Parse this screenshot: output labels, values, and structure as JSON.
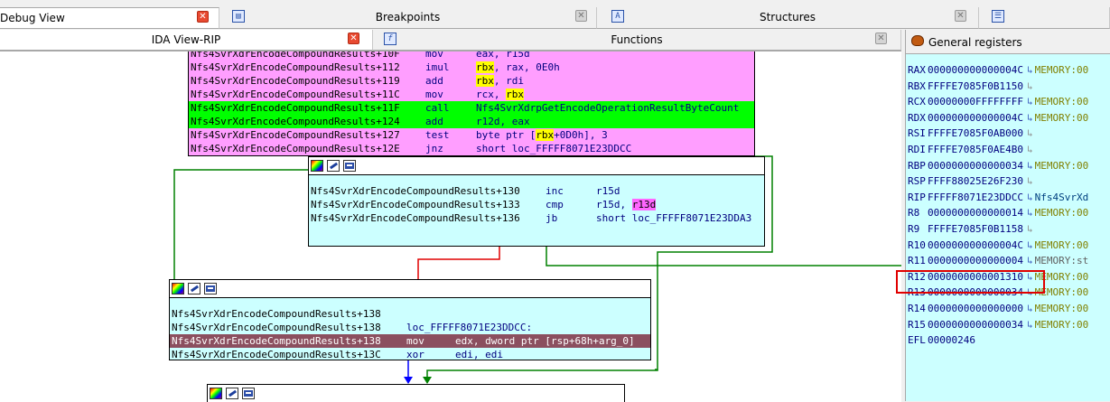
{
  "tabs_top": [
    {
      "label": "Debug View",
      "active": true
    },
    {
      "label": "Breakpoints",
      "active": false
    },
    {
      "label": "Structures",
      "active": false
    }
  ],
  "tabs_second": [
    {
      "label": "IDA View-RIP",
      "active": true
    },
    {
      "label": "Functions",
      "active": false
    }
  ],
  "icons": {
    "breakpoints": "breakpoints-icon",
    "structures": "structures-icon",
    "functions": "functions-icon",
    "extra": "list-icon",
    "registers": "bug-icon"
  },
  "colors": {
    "block_pink": "#ff9eff",
    "block_cyan": "#ccffff",
    "row_green": "#00ff00",
    "row_current": "#8b4f5f",
    "edge_green": "#008000",
    "edge_red": "#e00000",
    "edge_blue": "#0000ff"
  },
  "blocks": [
    {
      "rows": [
        {
          "addr": "Nfs4SvrXdrEncodeCompoundResults+10F",
          "mn": "mov",
          "ops": "eax, r15d",
          "hl": "none"
        },
        {
          "addr": "Nfs4SvrXdrEncodeCompoundResults+112",
          "mn": "imul",
          "ops_pre": "",
          "ops_hl": "rbx",
          "ops_post": ", rax, 0E0h",
          "hl": "none"
        },
        {
          "addr": "Nfs4SvrXdrEncodeCompoundResults+119",
          "mn": "add",
          "ops_pre": "",
          "ops_hl": "rbx",
          "ops_post": ", rdi",
          "hl": "none"
        },
        {
          "addr": "Nfs4SvrXdrEncodeCompoundResults+11C",
          "mn": "mov",
          "ops_pre": "rcx, ",
          "ops_hl": "rbx",
          "ops_post": "",
          "hl": "none"
        },
        {
          "addr": "Nfs4SvrXdrEncodeCompoundResults+11F",
          "mn": "call",
          "ops": "Nfs4SvrXdrpGetEncodeOperationResultByteCount",
          "hl": "green"
        },
        {
          "addr": "Nfs4SvrXdrEncodeCompoundResults+124",
          "mn": "add",
          "ops": "r12d, eax",
          "hl": "green"
        },
        {
          "addr": "Nfs4SvrXdrEncodeCompoundResults+127",
          "mn": "test",
          "ops_pre": "byte ptr [",
          "ops_hl": "rbx",
          "ops_post": "+0D0h], 3",
          "hl": "none"
        },
        {
          "addr": "Nfs4SvrXdrEncodeCompoundResults+12E",
          "mn": "jnz",
          "ops": "short loc_FFFFF8071E23DDCC",
          "hl": "none"
        }
      ]
    },
    {
      "rows": [
        {
          "addr": "Nfs4SvrXdrEncodeCompoundResults+130",
          "mn": "inc",
          "ops": "r15d"
        },
        {
          "addr": "Nfs4SvrXdrEncodeCompoundResults+133",
          "mn": "cmp",
          "ops_pre": "r15d, ",
          "ops_hl": "r13d",
          "ops_post": ""
        },
        {
          "addr": "Nfs4SvrXdrEncodeCompoundResults+136",
          "mn": "jb",
          "ops": "short loc_FFFFF8071E23DDA3"
        }
      ]
    },
    {
      "rows": [
        {
          "addr": "Nfs4SvrXdrEncodeCompoundResults+138",
          "mn": "",
          "ops": ""
        },
        {
          "addr": "Nfs4SvrXdrEncodeCompoundResults+138",
          "mn": "loc_FFFFF8071E23DDCC:",
          "ops": ""
        },
        {
          "addr": "Nfs4SvrXdrEncodeCompoundResults+138",
          "mn": "mov",
          "ops": "edx, dword ptr [rsp+68h+arg_0]",
          "hl": "current"
        },
        {
          "addr": "Nfs4SvrXdrEncodeCompoundResults+13C",
          "mn": "xor",
          "ops": "edi, edi"
        }
      ]
    }
  ],
  "registers_title": "General registers",
  "registers": [
    {
      "name": "RAX",
      "value": "000000000000004C",
      "arrow": "↳",
      "note": "MEMORY:00",
      "kind": "mem"
    },
    {
      "name": "RBX",
      "value": "FFFFE7085F0B1150",
      "arrow": "↳",
      "note": "",
      "kind": "none"
    },
    {
      "name": "RCX",
      "value": "00000000FFFFFFFF",
      "arrow": "↳",
      "note": "MEMORY:00",
      "kind": "mem"
    },
    {
      "name": "RDX",
      "value": "000000000000004C",
      "arrow": "↳",
      "note": "MEMORY:00",
      "kind": "mem"
    },
    {
      "name": "RSI",
      "value": "FFFFE7085F0AB000",
      "arrow": "↳",
      "note": "",
      "kind": "none"
    },
    {
      "name": "RDI",
      "value": "FFFFE7085F0AE4B0",
      "arrow": "↳",
      "note": "",
      "kind": "none"
    },
    {
      "name": "RBP",
      "value": "0000000000000034",
      "arrow": "↳",
      "note": "MEMORY:00",
      "kind": "mem"
    },
    {
      "name": "RSP",
      "value": "FFFF88025E26F230",
      "arrow": "↳",
      "note": "",
      "kind": "none"
    },
    {
      "name": "RIP",
      "value": "FFFFF8071E23DDCC",
      "arrow": "↳",
      "note": "Nfs4SvrXd",
      "kind": "code"
    },
    {
      "name": "R8",
      "value": "0000000000000014",
      "arrow": "↳",
      "note": "MEMORY:00",
      "kind": "mem"
    },
    {
      "name": "R9",
      "value": "FFFFE7085F0B1158",
      "arrow": "↳",
      "note": "",
      "kind": "none"
    },
    {
      "name": "R10",
      "value": "000000000000004C",
      "arrow": "↳",
      "note": "MEMORY:00",
      "kind": "mem"
    },
    {
      "name": "R11",
      "value": "0000000000000004",
      "arrow": "↳",
      "note": "MEMORY:st",
      "kind": "gray"
    },
    {
      "name": "R12",
      "value": "0000000000001310",
      "arrow": "↳",
      "note": "MEMORY:00",
      "kind": "mem"
    },
    {
      "name": "R13",
      "value": "0000000000000034",
      "arrow": "↳",
      "note": "MEMORY:00",
      "kind": "mem"
    },
    {
      "name": "R14",
      "value": "0000000000000000",
      "arrow": "↳",
      "note": "MEMORY:00",
      "kind": "mem"
    },
    {
      "name": "R15",
      "value": "0000000000000034",
      "arrow": "↳",
      "note": "MEMORY:00",
      "kind": "mem"
    },
    {
      "name": "EFL",
      "value": "00000246",
      "arrow": "",
      "note": "",
      "kind": "none"
    }
  ]
}
